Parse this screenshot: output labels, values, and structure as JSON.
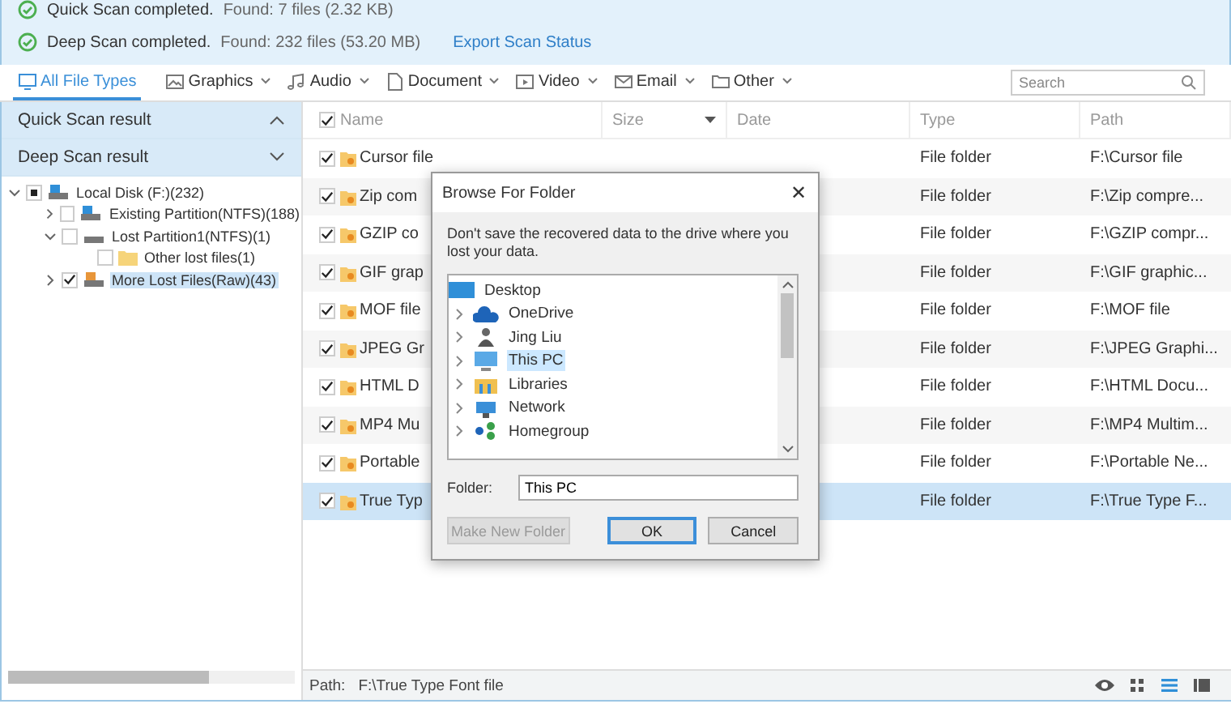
{
  "scan_status": [
    {
      "title": "Quick Scan completed.",
      "detail": "Found: 7 files (2.32 KB)"
    },
    {
      "title": "Deep Scan completed.",
      "detail": "Found: 232 files (53.20 MB)",
      "link": "Export Scan Status"
    }
  ],
  "filter_tabs": [
    {
      "label": "All File Types",
      "selected": true,
      "kind": "monitor",
      "dropdown": false
    },
    {
      "label": "Graphics",
      "selected": false,
      "kind": "picture",
      "dropdown": true
    },
    {
      "label": "Audio",
      "selected": false,
      "kind": "note",
      "dropdown": true
    },
    {
      "label": "Document",
      "selected": false,
      "kind": "page",
      "dropdown": true
    },
    {
      "label": "Video",
      "selected": false,
      "kind": "play",
      "dropdown": true
    },
    {
      "label": "Email",
      "selected": false,
      "kind": "mail",
      "dropdown": true
    },
    {
      "label": "Other",
      "selected": false,
      "kind": "folder",
      "dropdown": true
    }
  ],
  "search": {
    "placeholder": "Search"
  },
  "sidebar": {
    "sections": [
      {
        "label": "Quick Scan result",
        "expanded": true
      },
      {
        "label": "Deep Scan result",
        "expanded": false
      }
    ],
    "tree": [
      {
        "label": "Local Disk (F:)(232)",
        "kind": "disk",
        "expanded": true,
        "checked": false,
        "mixed": true,
        "selected": false,
        "children": [
          {
            "label": "Existing Partition(NTFS)(188)",
            "kind": "disk",
            "expanded": false,
            "checked": false,
            "mixed": false,
            "selected": false
          },
          {
            "label": "Lost Partition1(NTFS)(1)",
            "kind": "drive",
            "expanded": true,
            "checked": false,
            "mixed": false,
            "selected": false,
            "children": [
              {
                "label": "Other lost files(1)",
                "kind": "folder",
                "checked": false,
                "mixed": false,
                "selected": false
              }
            ]
          },
          {
            "label": "More Lost Files(Raw)(43)",
            "kind": "disk-orange",
            "expanded": false,
            "checked": true,
            "mixed": false,
            "selected": true
          }
        ]
      }
    ]
  },
  "table": {
    "columns": [
      "Name",
      "Size",
      "Date",
      "Type",
      "Path"
    ],
    "all_checked": true,
    "rows": [
      {
        "name": "Cursor file",
        "type": "File folder",
        "path": "F:\\Cursor file",
        "checked": true,
        "selected": false
      },
      {
        "name": "Zip com",
        "type": "File folder",
        "path": "F:\\Zip compre...",
        "checked": true,
        "selected": false
      },
      {
        "name": "GZIP co",
        "type": "File folder",
        "path": "F:\\GZIP compr...",
        "checked": true,
        "selected": false
      },
      {
        "name": "GIF grap",
        "type": "File folder",
        "path": "F:\\GIF graphic...",
        "checked": true,
        "selected": false
      },
      {
        "name": "MOF file",
        "type": "File folder",
        "path": "F:\\MOF file",
        "checked": true,
        "selected": false
      },
      {
        "name": "JPEG Gr",
        "type": "File folder",
        "path": "F:\\JPEG Graphi...",
        "checked": true,
        "selected": false
      },
      {
        "name": "HTML D",
        "type": "File folder",
        "path": "F:\\HTML Docu...",
        "checked": true,
        "selected": false
      },
      {
        "name": "MP4 Mu",
        "type": "File folder",
        "path": "F:\\MP4 Multim...",
        "checked": true,
        "selected": false
      },
      {
        "name": "Portable",
        "type": "File folder",
        "path": "F:\\Portable Ne...",
        "checked": true,
        "selected": false
      },
      {
        "name": "True Typ",
        "type": "File folder",
        "path": "F:\\True Type F...",
        "checked": true,
        "selected": true
      }
    ]
  },
  "status_bar": {
    "label": "Path:",
    "value": "F:\\True Type Font file",
    "views": [
      {
        "kind": "eye",
        "selected": false
      },
      {
        "kind": "grid",
        "selected": false
      },
      {
        "kind": "list",
        "selected": true
      },
      {
        "kind": "columns",
        "selected": false
      }
    ]
  },
  "dialog": {
    "title": "Browse For Folder",
    "close": "✕",
    "message": "Don't save the recovered data to the drive where you lost your data.",
    "folders": [
      {
        "label": "Desktop",
        "kind": "desktop",
        "expandable": false,
        "selected": false
      },
      {
        "label": "OneDrive",
        "kind": "cloud",
        "expandable": true,
        "selected": false
      },
      {
        "label": "Jing Liu",
        "kind": "person",
        "expandable": true,
        "selected": false
      },
      {
        "label": "This PC",
        "kind": "pc",
        "expandable": true,
        "selected": true
      },
      {
        "label": "Libraries",
        "kind": "library",
        "expandable": true,
        "selected": false
      },
      {
        "label": "Network",
        "kind": "network",
        "expandable": true,
        "selected": false
      },
      {
        "label": "Homegroup",
        "kind": "homegroup",
        "expandable": true,
        "selected": false
      }
    ],
    "folder_label": "Folder:",
    "folder_value": "This PC",
    "buttons": [
      {
        "label": "Make New Folder",
        "disabled": true,
        "focused": false
      },
      {
        "label": "OK",
        "disabled": false,
        "focused": true
      },
      {
        "label": "Cancel",
        "disabled": false,
        "focused": false
      }
    ]
  }
}
